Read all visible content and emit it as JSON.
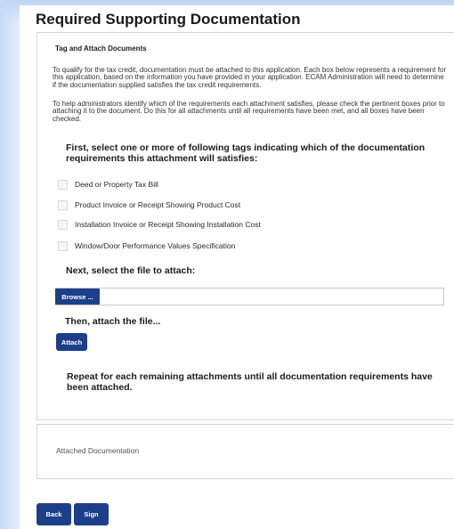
{
  "page": {
    "title": "Required Supporting Documentation"
  },
  "tag_panel": {
    "title": "Tag and Attach Documents",
    "paragraph1": "To qualify for the tax credit, documentation must be attached to this application. Each box below represents a requirement for this application, based on the information you have provided in your application. ECAM Administration will need to determine if the documentation supplied satisfies the tax credit requirements.",
    "paragraph2": "To help administrators identify which of the requirements each attachment satisfies, please check the pertinent boxes prior to attaching it to the document. Do this for all attachments until all requirements have been met, and all boxes have been checked.",
    "step1_heading": "First, select one or more of following tags indicating which of the documentation requirements this attachment will satisfies:",
    "tags": [
      {
        "label": "Deed or Property Tax Bill",
        "checked": false
      },
      {
        "label": "Product Invoice or Receipt Showing Product Cost",
        "checked": false
      },
      {
        "label": "Installation Invoice or Receipt Showing Installation Cost",
        "checked": false
      },
      {
        "label": "Window/Door Performance Values Specification",
        "checked": false
      }
    ],
    "step2_heading": "Next, select the file to attach:",
    "browse_label": "Browse ...",
    "file_value": "",
    "step3_heading": "Then, attach the file...",
    "attach_label": "Attach",
    "repeat_note": "Repeat for each remaining attachments until all documentation requirements have been attached."
  },
  "attached_panel": {
    "label": "Attached Documentation"
  },
  "footer": {
    "back_label": "Back",
    "sign_label": "Sign"
  },
  "colors": {
    "button_bg": "#1d3f8a",
    "background_glow": "#bcd3f2"
  }
}
